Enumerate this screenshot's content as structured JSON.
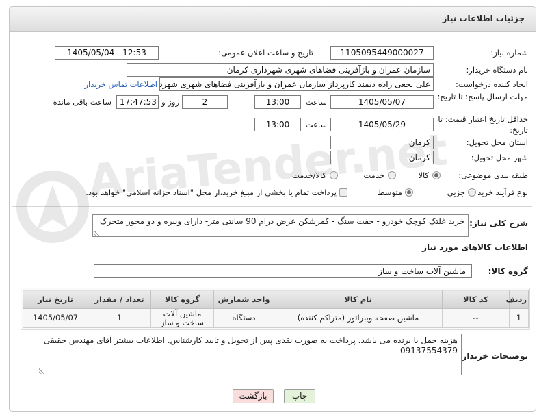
{
  "header": {
    "title": "جزئیات اطلاعات نیاز"
  },
  "fields": {
    "need_number": {
      "label": "شماره نیاز:",
      "value": "1105095449000027"
    },
    "announce_datetime": {
      "label": "تاریخ و ساعت اعلان عمومی:",
      "value": "1405/05/04 - 12:53"
    },
    "buyer_org": {
      "label": "نام دستگاه خریدار:",
      "value": "سازمان عمران و بازآفرینی فضاهای شهری شهرداری کرمان"
    },
    "creator": {
      "label": "ایجاد کننده درخواست:",
      "value": "علی نخعی زاده دیمند کارپرداز سازمان عمران و بازآفرینی فضاهای شهری شهردا",
      "contact_link": "اطلاعات تماس خریدار"
    },
    "response_deadline": {
      "label": "مهلت ارسال پاسخ: تا تاریخ:",
      "date": "1405/05/07",
      "time_label": "ساعت",
      "time": "13:00",
      "days": "2",
      "days_label": "روز و",
      "remaining_time": "17:47:53",
      "remaining_label": "ساعت باقی مانده"
    },
    "price_validity": {
      "label": "حداقل تاریخ اعتبار قیمت: تا تاریخ:",
      "date": "1405/05/29",
      "time_label": "ساعت",
      "time": "13:00"
    },
    "delivery_province": {
      "label": "استان محل تحویل:",
      "value": "کرمان"
    },
    "delivery_city": {
      "label": "شهر محل تحویل:",
      "value": "کرمان"
    },
    "subject_category": {
      "label": "طبقه بندی موضوعی:",
      "options": [
        {
          "label": "کالا",
          "selected": true
        },
        {
          "label": "خدمت",
          "selected": false
        },
        {
          "label": "کالا/خدمت",
          "selected": false
        }
      ]
    },
    "purchase_process": {
      "label": "نوع فرآیند خرید :",
      "options": [
        {
          "label": "جزیی",
          "selected": false
        },
        {
          "label": "متوسط",
          "selected": true
        }
      ],
      "treasury_payment": {
        "label": "پرداخت تمام یا بخشی از مبلغ خرید،از محل \"اسناد خزانه اسلامی\" خواهد بود.",
        "checked": false
      }
    }
  },
  "need_description": {
    "label": "شرح کلی نیاز:",
    "value": "خرید غلتک کوچک خودرو - جفت سنگ - کمرشکن عرض درام 90 سانتی متر- دارای ویبره و دو محور متحرک"
  },
  "items_section": {
    "title": "اطلاعات کالاهای مورد نیاز",
    "group_label": "گروه کالا:",
    "group_value": "ماشین آلات ساخت و ساز"
  },
  "items_table": {
    "columns": [
      "ردیف",
      "کد کالا",
      "نام کالا",
      "واحد شمارش",
      "گروه کالا",
      "تعداد / مقدار",
      "تاریخ نیاز"
    ],
    "rows": [
      [
        "1",
        "--",
        "ماشین صفحه ویبراتور (متراکم کننده)",
        "دستگاه",
        "ماشین آلات ساخت و ساز",
        "1",
        "1405/05/07"
      ]
    ]
  },
  "buyer_notes": {
    "label": "توضیحات خریدار:",
    "value": "هزینه حمل با برنده می باشد. پرداخت به صورت نقدی پس از تحویل و تایید کارشناس. اطلاعات بیشتر آقای مهندس حقیقی 09137554379"
  },
  "buttons": {
    "print": "چاپ",
    "back": "بازگشت"
  },
  "watermark": {
    "text": "AriaTender.net"
  },
  "colors": {
    "header_bg": "#dedede",
    "link": "#2a62b8",
    "print_button_bg": "#e3f2d8",
    "back_button_bg": "#f9dcdc"
  }
}
